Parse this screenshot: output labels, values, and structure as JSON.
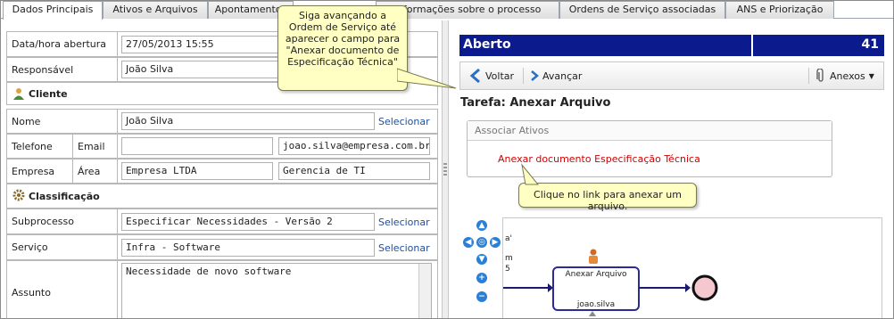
{
  "tabs": [
    "Dados Principais",
    "Ativos e Arquivos",
    "Apontamentos",
    "Informações sobre o processo",
    "Ordens de Serviço associadas",
    "ANS e Priorização"
  ],
  "form": {
    "data_abertura_label": "Data/hora abertura",
    "data_abertura_value": "27/05/2013 15:55",
    "responsavel_label": "Responsável",
    "responsavel_value": "João Silva",
    "cliente_section": "Cliente",
    "nome_label": "Nome",
    "nome_value": "João Silva",
    "telefone_label": "Telefone",
    "email_label": "Email",
    "email_value": "joao.silva@empresa.com.br",
    "empresa_label": "Empresa",
    "area_label": "Área",
    "empresa_value": "Empresa LTDA",
    "area_value": "Gerencia de TI",
    "classificacao_section": "Classificação",
    "subprocesso_label": "Subprocesso",
    "subprocesso_value": "Especificar Necessidades - Versão 2",
    "servico_label": "Serviço",
    "servico_value": "Infra - Software",
    "assunto_label": "Assunto",
    "assunto_value": "Necessidade de novo software",
    "selecionar": "Selecionar"
  },
  "status": {
    "title": "Aberto",
    "number": "41"
  },
  "toolbar": {
    "voltar": "Voltar",
    "avancar": "Avançar",
    "anexos": "Anexos"
  },
  "tarefa": "Tarefa: Anexar Arquivo",
  "associar": {
    "header": "Associar Ativos",
    "link": "Anexar documento Especificação Técnica"
  },
  "diagram": {
    "task_name": "Anexar Arquivo",
    "task_user": "joao.silva",
    "frag1": "a'",
    "frag2": "m",
    "frag3": "5"
  },
  "callouts": {
    "top": "Siga avançando a Ordem de Serviço até aparecer o campo para \"Anexar documento de Especificação Técnica\"",
    "bottom": "Clique no link para anexar um arquivo."
  },
  "colors": {
    "titlebar": "#0b1a8c",
    "link_red": "#d40000",
    "callout_bg": "#ffffc4",
    "select_link": "#1f4e9a"
  }
}
